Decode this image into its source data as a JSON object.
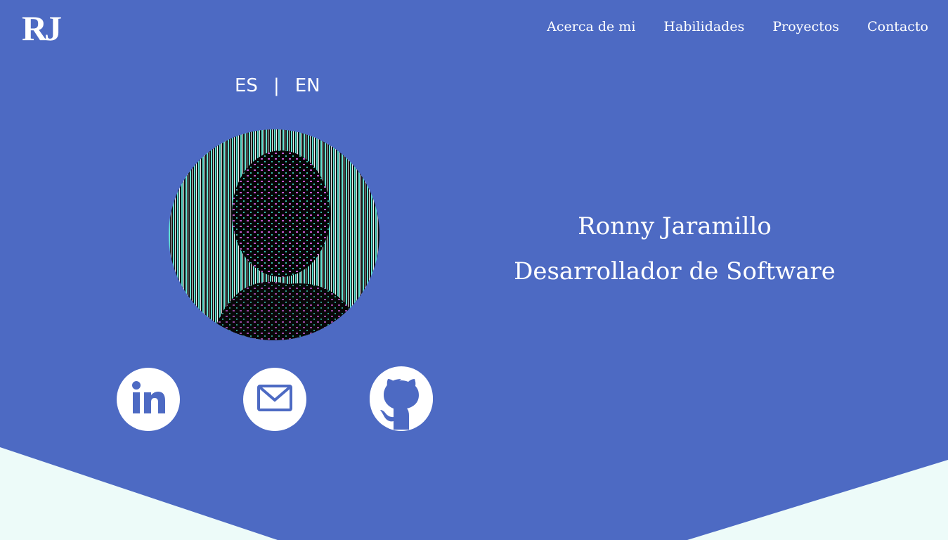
{
  "header": {
    "logo": "RJ",
    "nav": [
      "Acerca de mi",
      "Habilidades",
      "Proyectos",
      "Contacto"
    ]
  },
  "language": {
    "es": "ES",
    "separator": "|",
    "en": "EN"
  },
  "profile": {
    "name": "Ronny Jaramillo",
    "role": "Desarrollador de Software"
  },
  "social": [
    {
      "icon": "linkedin-icon"
    },
    {
      "icon": "mail-icon"
    },
    {
      "icon": "github-icon"
    }
  ],
  "colors": {
    "background": "#4d6ac3",
    "text": "#ffffff",
    "lower_section": "#edfbf9"
  }
}
